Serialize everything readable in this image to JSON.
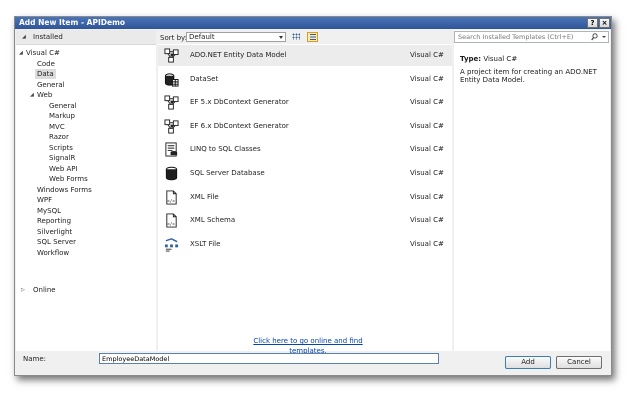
{
  "window": {
    "title": "Add New Item - APIDemo",
    "help_glyph": "?",
    "close_glyph": "×"
  },
  "left_pane": {
    "installed_label": "Installed",
    "online_label": "Online",
    "tree": [
      {
        "label": "Visual C#",
        "level": 0,
        "expandable": true
      },
      {
        "label": "Code",
        "level": 1
      },
      {
        "label": "Data",
        "level": 1,
        "selected": true
      },
      {
        "label": "General",
        "level": 1
      },
      {
        "label": "Web",
        "level": 1,
        "expandable": true
      },
      {
        "label": "General",
        "level": 2
      },
      {
        "label": "Markup",
        "level": 2
      },
      {
        "label": "MVC",
        "level": 2
      },
      {
        "label": "Razor",
        "level": 2
      },
      {
        "label": "Scripts",
        "level": 2
      },
      {
        "label": "SignalR",
        "level": 2
      },
      {
        "label": "Web API",
        "level": 2
      },
      {
        "label": "Web Forms",
        "level": 2
      },
      {
        "label": "Windows Forms",
        "level": 1
      },
      {
        "label": "WPF",
        "level": 1
      },
      {
        "label": "MySQL",
        "level": 1
      },
      {
        "label": "Reporting",
        "level": 1
      },
      {
        "label": "Silverlight",
        "level": 1
      },
      {
        "label": "SQL Server",
        "level": 1
      },
      {
        "label": "Workflow",
        "level": 1
      }
    ]
  },
  "toolbar": {
    "sort_label": "Sort by:",
    "sort_value": "Default"
  },
  "templates": [
    {
      "name": "ADO.NET Entity Data Model",
      "lang": "Visual C#",
      "icon": "entity-model-icon",
      "selected": true
    },
    {
      "name": "DataSet",
      "lang": "Visual C#",
      "icon": "dataset-icon"
    },
    {
      "name": "EF 5.x DbContext Generator",
      "lang": "Visual C#",
      "icon": "entity-model-icon"
    },
    {
      "name": "EF 6.x DbContext Generator",
      "lang": "Visual C#",
      "icon": "entity-model-icon"
    },
    {
      "name": "LINQ to SQL Classes",
      "lang": "Visual C#",
      "icon": "linq-icon"
    },
    {
      "name": "SQL Server Database",
      "lang": "Visual C#",
      "icon": "database-icon"
    },
    {
      "name": "XML File",
      "lang": "Visual C#",
      "icon": "xml-file-icon"
    },
    {
      "name": "XML Schema",
      "lang": "Visual C#",
      "icon": "xml-file-icon"
    },
    {
      "name": "XSLT File",
      "lang": "Visual C#",
      "icon": "xslt-icon"
    }
  ],
  "online_link": "Click here to go online and find templates.",
  "right_pane": {
    "search_placeholder": "Search Installed Templates (Ctrl+E)",
    "type_key": "Type:",
    "type_value": "Visual C#",
    "description": "A project item for creating an ADO.NET Entity Data Model."
  },
  "footer": {
    "name_label": "Name:",
    "name_value": "EmployeeDataModel",
    "add_label": "Add",
    "cancel_label": "Cancel"
  },
  "colors": {
    "title_bar": "#2f5597",
    "link": "#0645ad",
    "selection": "#dcdcdc",
    "dialog_bg": "#f0f0f0"
  }
}
